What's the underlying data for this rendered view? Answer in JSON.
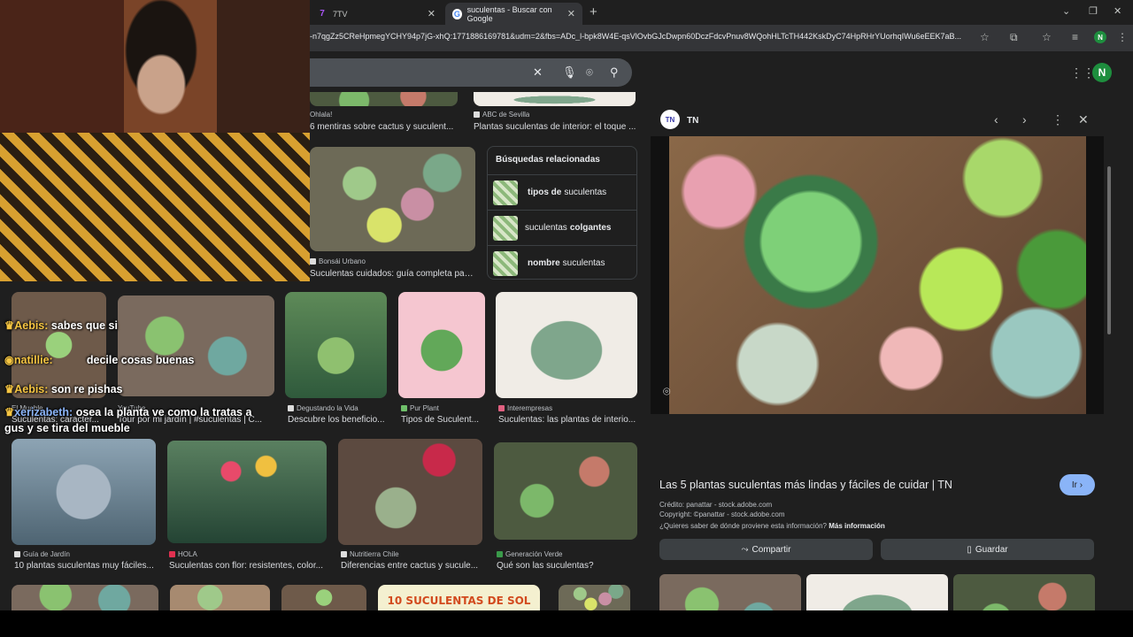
{
  "browser": {
    "tabs": [
      {
        "label": "7TV",
        "icon": "7tv-icon"
      },
      {
        "label": "suculentas - Buscar con Google",
        "icon": "google-icon"
      }
    ],
    "url": "-n7qgZz5CReHpmegYCHY94p7jG-xhQ:1771886169781&udm=2&fbs=ADc_l-bpk8W4E-qsVlOvbGJcDwpn60DczFdcvPnuv8WQohHLTcTH442KskDyC74HpRHrYUorhqIWu6eEEK7aB...",
    "profile_letter": "N"
  },
  "search": {
    "avatar_letter": "N"
  },
  "results": {
    "top_row": [
      {
        "source": "Ohlala!",
        "title": "6 mentiras sobre cactus y suculent..."
      },
      {
        "source": "ABC de Sevilla",
        "title": "Plantas suculentas de interior: el toque ..."
      }
    ],
    "bonsai": {
      "source": "Bonsái Urbano",
      "title": "Suculentas cuidados: guía completa par..."
    },
    "row2": [
      {
        "source": "El Mueble",
        "title": "Suculentas: caracter..."
      },
      {
        "source": "YouTube",
        "title": "Tour por mi jardín | #suculentas | C..."
      },
      {
        "source": "Degustando la Vida",
        "title": "Descubre los beneficio..."
      },
      {
        "source": "Pur Plant",
        "title": "Tipos de Suculent..."
      },
      {
        "source": "Interempresas",
        "title": "Suculentas: las plantas de interio..."
      }
    ],
    "row3": [
      {
        "source": "Guía de Jardín",
        "title": "10 plantas suculentas muy fáciles..."
      },
      {
        "source": "HOLA",
        "title": "Suculentas con flor: resistentes, color..."
      },
      {
        "source": "Nutritierra Chile",
        "title": "Diferencias entre cactus y sucule..."
      },
      {
        "source": "Generación Verde",
        "title": "Qué son las suculentas?"
      }
    ],
    "banner_text": "10 SUCULENTAS DE SOL"
  },
  "related": {
    "heading": "Búsquedas relacionadas",
    "items": [
      {
        "bold": "tipos de",
        "rest": "suculentas"
      },
      {
        "pre": "suculentas",
        "bold": "colgantes"
      },
      {
        "bold": "nombre",
        "rest": "suculentas"
      }
    ]
  },
  "preview": {
    "site": "TN",
    "logo_text": "TN",
    "title": "Las 5 plantas suculentas más lindas y fáciles de cuidar | TN",
    "go_label": "Ir ›",
    "credit": "Crédito: panattar - stock.adobe.com",
    "copyright": "Copyright: ©panattar - stock.adobe.com",
    "source_question": "¿Quieres saber de dónde proviene esta información?",
    "more_info": "Más información",
    "share_label": "Compartir",
    "save_label": "Guardar"
  },
  "chat": [
    {
      "user": "Aebis:",
      "message": "sabes que si"
    },
    {
      "user": "natillie:",
      "message": "decile cosas buenas"
    },
    {
      "user": "Aebis:",
      "message": "son re pishas"
    },
    {
      "user": "xerizabeth:",
      "message": "osea la planta ve como la tratas a"
    },
    {
      "user": "",
      "message": "gus y se tira del mueble"
    }
  ]
}
